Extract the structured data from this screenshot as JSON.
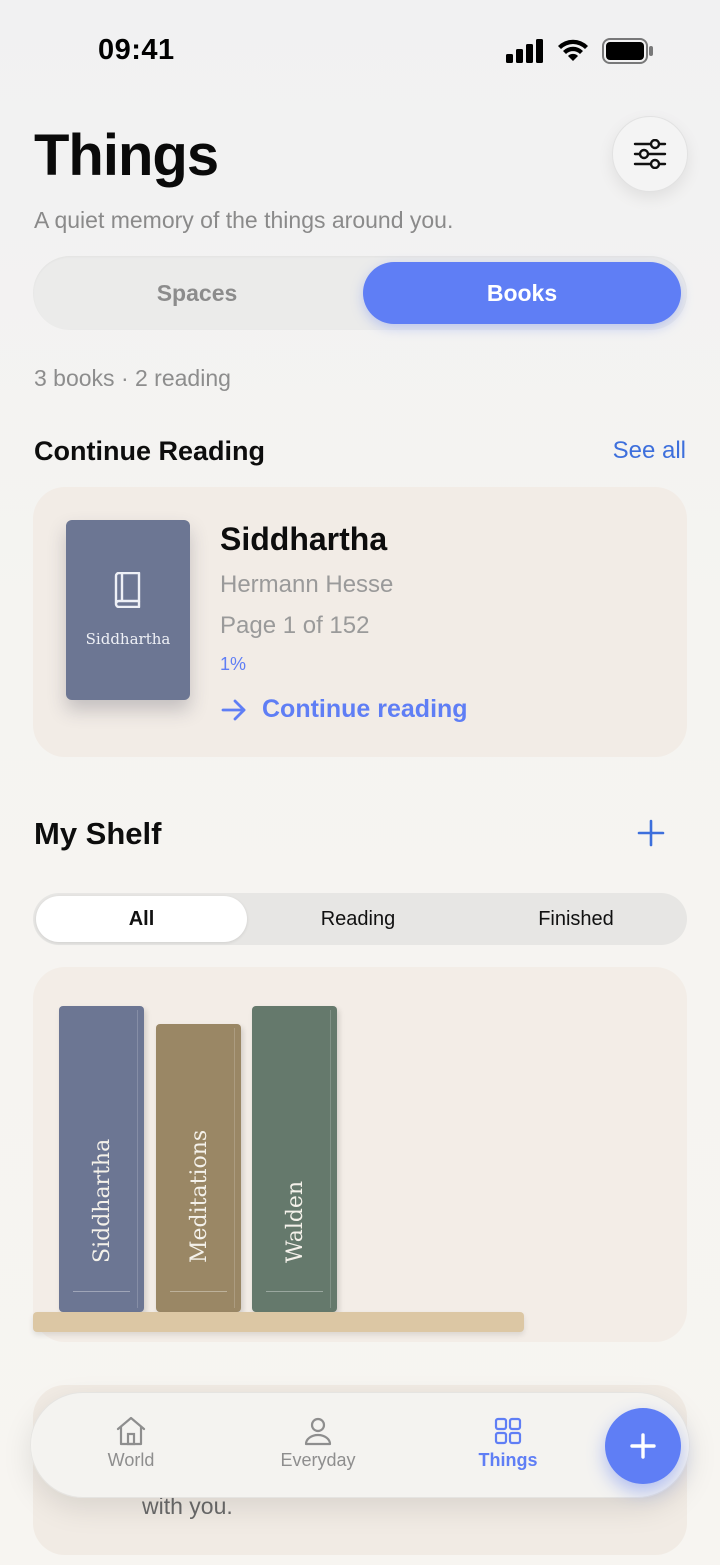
{
  "status_bar": {
    "time": "09:41"
  },
  "header": {
    "title": "Things",
    "subtitle": "A quiet memory of the things around you.",
    "settings_icon": "sliders-icon"
  },
  "segments": {
    "items": [
      "Spaces",
      "Books"
    ],
    "selected": "Books"
  },
  "summary": "3 books · 2 reading",
  "continue_reading": {
    "section_title": "Continue Reading",
    "see_all": "See all",
    "book": {
      "cover_title": "Siddhartha",
      "title": "Siddhartha",
      "author": "Hermann Hesse",
      "page_text": "Page 1 of 152",
      "progress_text": "1%",
      "cover_color": "#6c7693"
    },
    "action": "Continue reading"
  },
  "shelf": {
    "section_title": "My Shelf",
    "filters": [
      "All",
      "Reading",
      "Finished"
    ],
    "selected_filter": "All",
    "books": [
      {
        "title": "Siddhartha",
        "color": "#6c7693"
      },
      {
        "title": "Meditations",
        "color": "#9a8765"
      },
      {
        "title": "Walden",
        "color": "#65796c"
      }
    ]
  },
  "bottom_card": {
    "text": "with you."
  },
  "tabbar": {
    "tabs": [
      {
        "label": "World",
        "icon": "house-icon"
      },
      {
        "label": "Everyday",
        "icon": "person-icon"
      },
      {
        "label": "Things",
        "icon": "grid-icon"
      }
    ],
    "active": "Things",
    "fab_icon": "plus-icon"
  },
  "colors": {
    "accent": "#5f7ef5",
    "link": "#3d6fdc",
    "card": "#f2ece6"
  }
}
